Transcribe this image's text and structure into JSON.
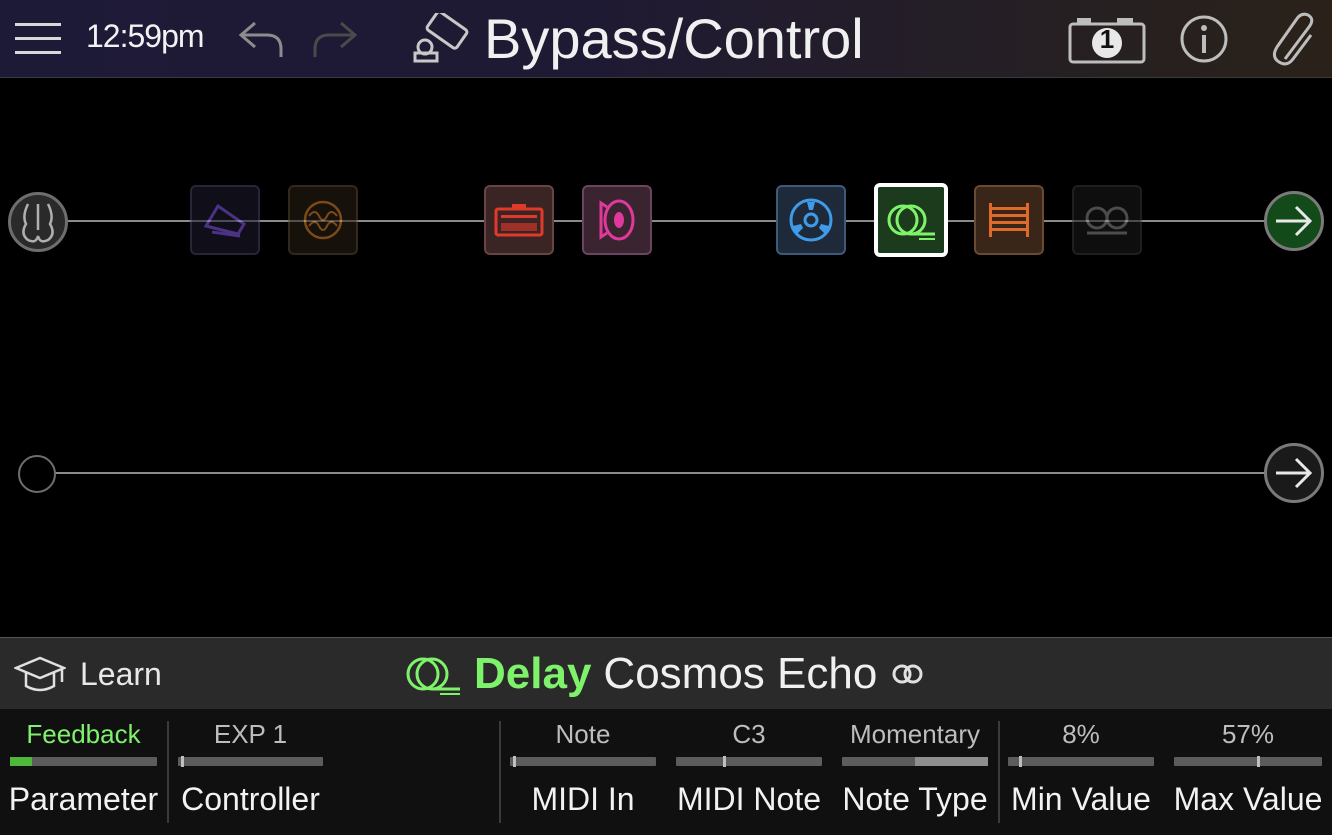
{
  "header": {
    "time": "12:59pm",
    "title": "Bypass/Control",
    "snapshot_number": "1",
    "icons": [
      "menu-icon",
      "undo-icon",
      "redo-icon",
      "pedal-icon",
      "camera-icon",
      "info-icon",
      "paperclip-icon"
    ]
  },
  "signal_paths": [
    {
      "name": "path-1",
      "blocks": [
        {
          "type": "wah",
          "color": "#8a5cf0",
          "state": "bypassed"
        },
        {
          "type": "modulation",
          "color": "#e0882a",
          "state": "bypassed"
        },
        {
          "type": "amp",
          "color": "#e03a2a",
          "state": "on"
        },
        {
          "type": "cab",
          "color": "#e0399c",
          "state": "on"
        },
        {
          "type": "reverb",
          "color": "#3f9be8",
          "state": "on"
        },
        {
          "type": "delay",
          "color": "#7ff26b",
          "state": "selected"
        },
        {
          "type": "eq",
          "color": "#e06a2a",
          "state": "on"
        },
        {
          "type": "looper",
          "color": "#8a8a8a",
          "state": "bypassed"
        }
      ]
    },
    {
      "name": "path-2",
      "blocks": []
    }
  ],
  "model": {
    "learn_label": "Learn",
    "category": "Delay",
    "name": "Cosmos Echo",
    "accent_color": "#7ff26b"
  },
  "params": [
    {
      "value": "Feedback",
      "label": "Parameter",
      "level": 0.15,
      "active": true
    },
    {
      "value": "EXP 1",
      "label": "Controller",
      "level": 0.03,
      "active": false
    },
    {
      "value": "Note",
      "label": "MIDI In",
      "level": 0.03,
      "active": false
    },
    {
      "value": "C3",
      "label": "MIDI Note",
      "level": 0.33,
      "active": false
    },
    {
      "value": "Momentary",
      "label": "Note Type",
      "level": 0.5,
      "active": false
    },
    {
      "value": "8%",
      "label": "Min Value",
      "level": 0.08,
      "active": false
    },
    {
      "value": "57%",
      "label": "Max Value",
      "level": 0.57,
      "active": false
    }
  ]
}
